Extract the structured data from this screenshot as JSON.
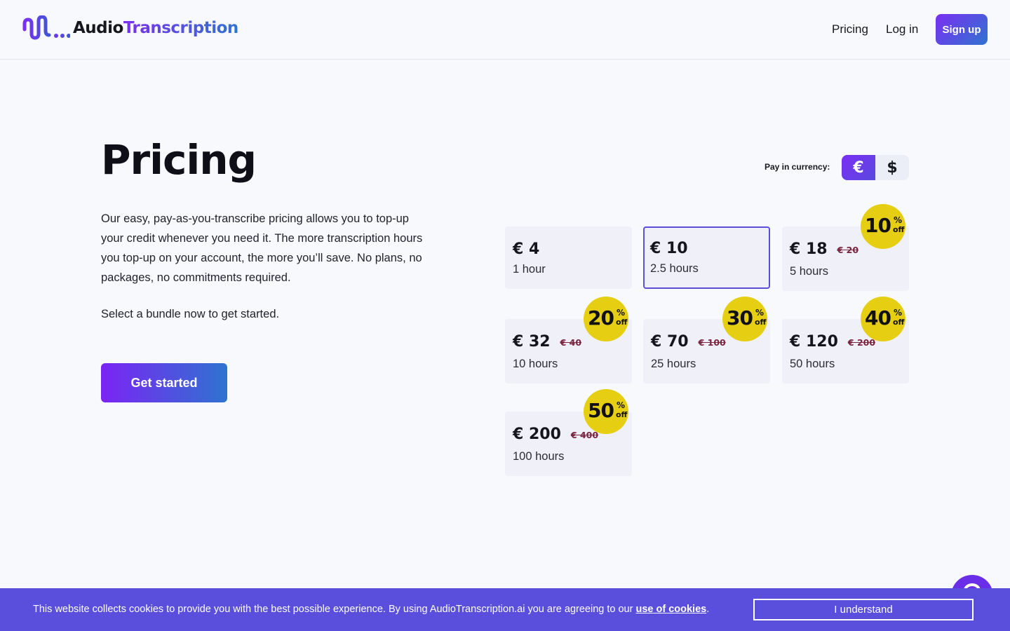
{
  "header": {
    "logo_part1": "Audio",
    "logo_part2": "Transcription",
    "nav_pricing": "Pricing",
    "nav_login": "Log in",
    "signup": "Sign up"
  },
  "main": {
    "title": "Pricing",
    "description": "Our easy, pay-as-you-transcribe pricing allows you to top-up your credit whenever you need it. The more transcription hours you top-up on your account, the more you’ll save. No plans, no packages, no commitments required.",
    "cta_text": "Select a bundle now to get started.",
    "get_started": "Get started"
  },
  "currency": {
    "label": "Pay in currency:",
    "eur": "€",
    "usd": "$",
    "selected": "€"
  },
  "bundles": [
    {
      "price": "€ 4",
      "old_price": "",
      "hours": "1 hour",
      "discount": "",
      "selected": false
    },
    {
      "price": "€ 10",
      "old_price": "",
      "hours": "2.5 hours",
      "discount": "",
      "selected": true
    },
    {
      "price": "€ 18",
      "old_price": "€ 20",
      "hours": "5 hours",
      "discount": "10",
      "selected": false
    },
    {
      "price": "€ 32",
      "old_price": "€ 40",
      "hours": "10 hours",
      "discount": "20",
      "selected": false
    },
    {
      "price": "€ 70",
      "old_price": "€ 100",
      "hours": "25 hours",
      "discount": "30",
      "selected": false
    },
    {
      "price": "€ 120",
      "old_price": "€ 200",
      "hours": "50 hours",
      "discount": "40",
      "selected": false
    },
    {
      "price": "€ 200",
      "old_price": "€ 400",
      "hours": "100 hours",
      "discount": "50",
      "selected": false
    }
  ],
  "badge_labels": {
    "percent": "%",
    "off": "off"
  },
  "cookie": {
    "text": "This website collects cookies to provide you with the best possible experience. By using AudioTranscription.ai you are agreeing to our ",
    "link": "use of cookies",
    "suffix": ".",
    "button": "I understand"
  },
  "icons": {
    "logo": "waveform-icon",
    "chat": "chat-icon"
  },
  "colors": {
    "accent_purple": "#7b2ff2",
    "accent_blue": "#2f73d0",
    "badge_yellow": "#e6cf12",
    "cookie_bg": "#5a4fdc"
  }
}
